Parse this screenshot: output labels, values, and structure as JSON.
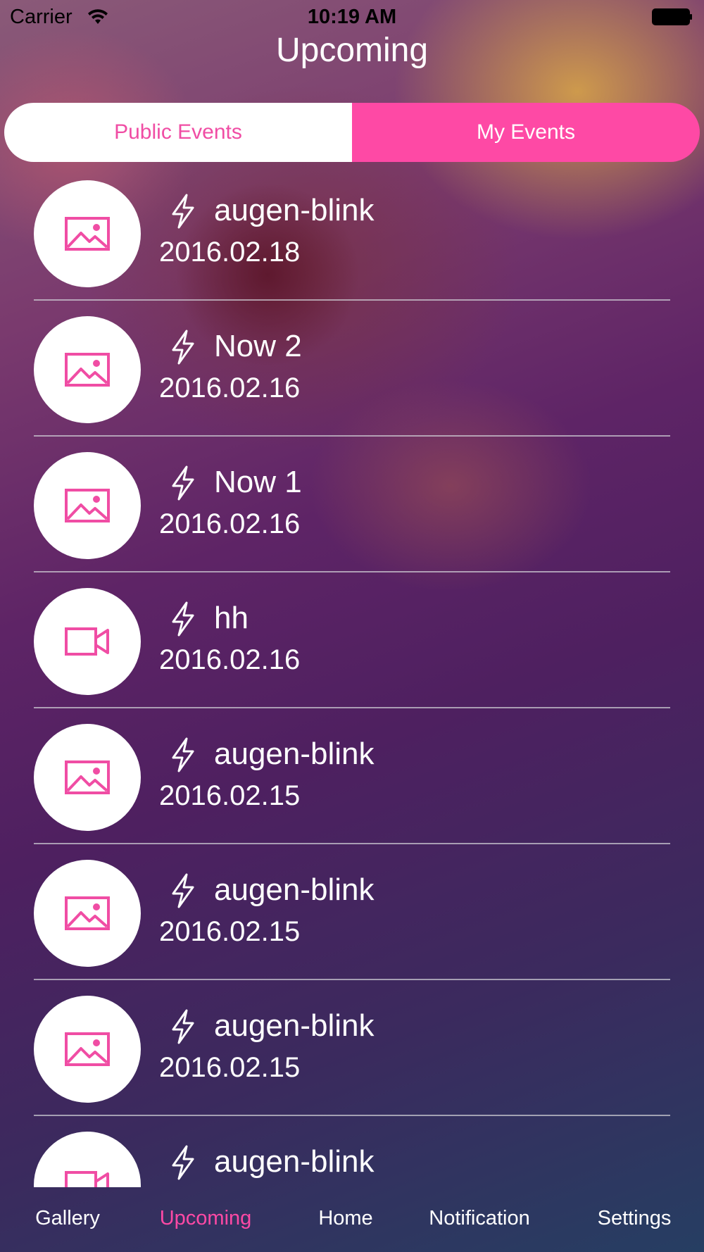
{
  "status_bar": {
    "carrier": "Carrier",
    "time": "10:19 AM",
    "icons": [
      "wifi-icon",
      "battery-icon"
    ]
  },
  "nav": {
    "title": "Upcoming"
  },
  "segments": [
    {
      "label": "Public Events",
      "selected": false
    },
    {
      "label": "My Events",
      "selected": true
    }
  ],
  "events": [
    {
      "title": "augen-blink",
      "date": "2016.02.18",
      "media_icon": "image-icon",
      "status_icon": "bolt-icon"
    },
    {
      "title": "Now 2",
      "date": "2016.02.16",
      "media_icon": "image-icon",
      "status_icon": "bolt-icon"
    },
    {
      "title": "Now 1",
      "date": "2016.02.16",
      "media_icon": "image-icon",
      "status_icon": "bolt-icon"
    },
    {
      "title": "hh",
      "date": "2016.02.16",
      "media_icon": "video-camera-icon",
      "status_icon": "bolt-icon"
    },
    {
      "title": "augen-blink",
      "date": "2016.02.15",
      "media_icon": "image-icon",
      "status_icon": "bolt-icon"
    },
    {
      "title": "augen-blink",
      "date": "2016.02.15",
      "media_icon": "image-icon",
      "status_icon": "bolt-icon"
    },
    {
      "title": "augen-blink",
      "date": "2016.02.15",
      "media_icon": "image-icon",
      "status_icon": "bolt-icon"
    },
    {
      "title": "augen-blink",
      "date": "",
      "media_icon": "video-camera-icon",
      "status_icon": "bolt-icon"
    }
  ],
  "tabs": [
    {
      "label": "Gallery",
      "active": false
    },
    {
      "label": "Upcoming",
      "active": true
    },
    {
      "label": "Home",
      "active": false
    },
    {
      "label": "Notification",
      "active": false
    },
    {
      "label": "Settings",
      "active": false
    }
  ],
  "colors": {
    "accent": "#fe49a5",
    "segment_inactive_bg": "#ffffff",
    "icon_pink": "#f04da4"
  }
}
